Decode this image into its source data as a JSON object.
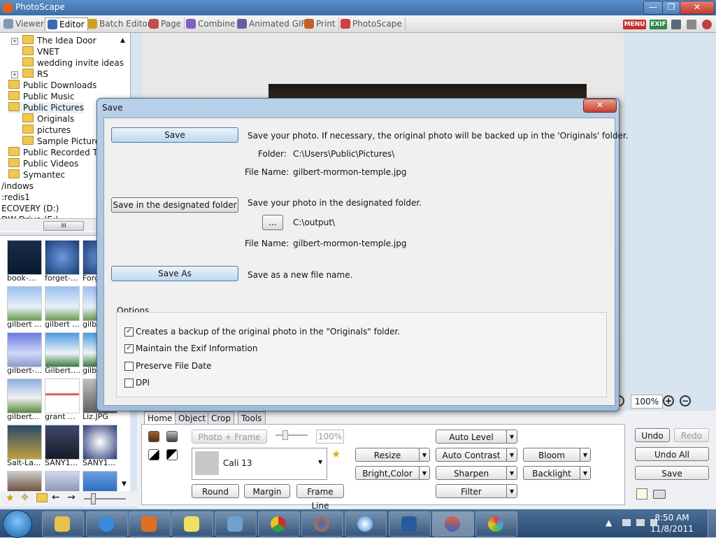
{
  "window": {
    "title": "PhotoScape",
    "controls": {
      "minimize": "—",
      "restore": "❐",
      "close": "✕"
    }
  },
  "tabs": [
    "Viewer",
    "Editor",
    "Batch Editor",
    "Page",
    "Combine",
    "Animated GIF",
    "Print",
    "PhotoScape"
  ],
  "top_icons": {
    "menu": "MENU",
    "exif": "EXIF"
  },
  "tree": {
    "items": [
      "The Idea Door",
      "VNET",
      "wedding invite ideas",
      "RS",
      "Public Downloads",
      "Public Music",
      "Public Pictures",
      "Originals",
      "pictures",
      "Sample Pictures",
      "Public Recorded TV",
      "Public Videos",
      "Symantec",
      "/indows",
      ":redis1",
      "ECOVERY (D:)",
      "DW Drive (E:)"
    ],
    "scroll_grip": "III"
  },
  "thumbnails": [
    "book-...",
    "forget-...",
    "Forg",
    "gilbert ...",
    "gilbert ...",
    "gilbe",
    "gilbert-...",
    "Gilbert....",
    "gilbe",
    "gilbert...",
    "grant ...",
    "Liz.JPG",
    "Salt-La...",
    "SANY1...",
    "SANY1..."
  ],
  "zoom": {
    "value": "100%"
  },
  "bottom_tabs": [
    "Home",
    "Object",
    "Crop",
    "Tools"
  ],
  "home": {
    "photo_frame": "Photo + Frame",
    "slider_value": "100%",
    "frame_name": "Cali 13",
    "round": "Round",
    "margin": "Margin",
    "frame_line": "Frame Line",
    "resize": "Resize",
    "bright_color": "Bright,Color",
    "auto_level": "Auto Level",
    "auto_contrast": "Auto Contrast",
    "sharpen": "Sharpen",
    "filter": "Filter",
    "bloom": "Bloom",
    "backlight": "Backlight"
  },
  "right_panel": {
    "undo": "Undo",
    "redo": "Redo",
    "undo_all": "Undo All",
    "save": "Save"
  },
  "dialog": {
    "title": "Save",
    "close": "✕",
    "save_button": "Save",
    "save_desc": "Save your photo. If necessary, the original photo will be backed up in the 'Originals' folder.",
    "folder_label": "Folder:",
    "folder_value": "C:\\Users\\Public\\Pictures\\",
    "file_name_label": "File Name:",
    "file_name_value": "gilbert-mormon-temple.jpg",
    "designated_button": "Save in the designated folder",
    "designated_desc": "Save your photo in the designated folder.",
    "browse_button": "...",
    "designated_folder": "C:\\output\\",
    "designated_file_label": "File Name:",
    "designated_file_value": "gilbert-mormon-temple.jpg",
    "save_as_button": "Save As",
    "save_as_desc": "Save as a new file name.",
    "options_label": "Options",
    "options": [
      {
        "label": "Creates a backup of the original photo in the \"Originals\" folder.",
        "checked": true
      },
      {
        "label": "Maintain the Exif Information",
        "checked": true
      },
      {
        "label": "Preserve File Date",
        "checked": false
      },
      {
        "label": "DPI",
        "checked": false
      }
    ]
  },
  "taskbar": {
    "time": "8:50 AM",
    "date": "11/8/2011",
    "tray_arrow": "▲"
  },
  "colors": {
    "dialog_button": "#bcd8f0",
    "title_bar": "#3a6ea8",
    "taskbar": "#2a4a70"
  }
}
